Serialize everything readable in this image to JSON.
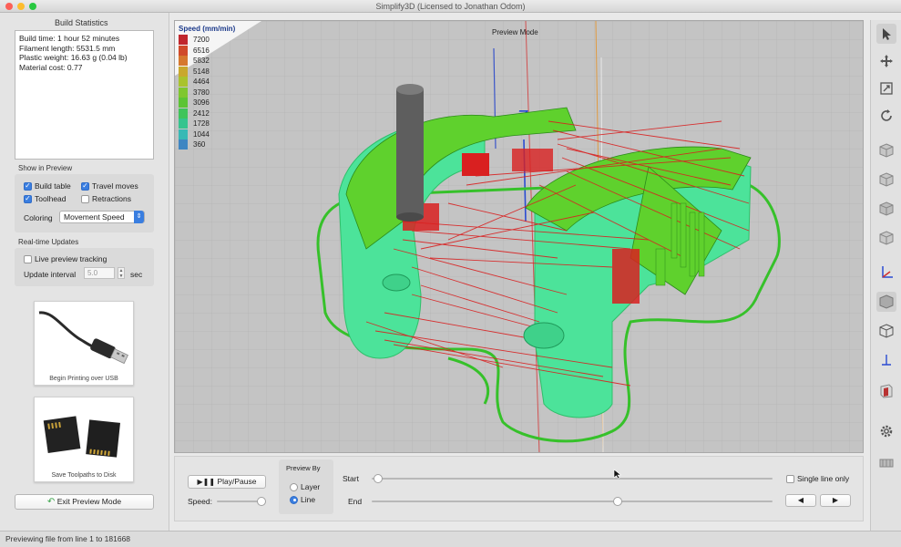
{
  "window": {
    "title": "Simplify3D (Licensed to Jonathan Odom)"
  },
  "build_stats": {
    "title": "Build Statistics",
    "lines": [
      "Build time: 1 hour 52 minutes",
      "Filament length: 5531.5 mm",
      "Plastic weight: 16.63 g (0.04 lb)",
      "Material cost: 0.77"
    ]
  },
  "show_in_preview": {
    "title": "Show in Preview",
    "build_table": "Build table",
    "travel_moves": "Travel moves",
    "toolhead": "Toolhead",
    "retractions": "Retractions",
    "coloring_label": "Coloring",
    "coloring_value": "Movement Speed"
  },
  "realtime": {
    "title": "Real-time Updates",
    "live_tracking": "Live preview tracking",
    "interval_label": "Update interval",
    "interval_value": "5.0",
    "interval_unit": "sec"
  },
  "cards": {
    "usb": "Begin Printing over USB",
    "sd": "Save Toolpaths to Disk"
  },
  "exit_button": "Exit Preview Mode",
  "viewport": {
    "title": "Preview Mode",
    "legend_title": "Speed (mm/min)",
    "legend": [
      {
        "value": "7200",
        "color": "#c0272d"
      },
      {
        "value": "6516",
        "color": "#d04a2a"
      },
      {
        "value": "5832",
        "color": "#d6782e"
      },
      {
        "value": "5148",
        "color": "#c9a82c"
      },
      {
        "value": "4464",
        "color": "#a9c32c"
      },
      {
        "value": "3780",
        "color": "#7fc72e"
      },
      {
        "value": "3096",
        "color": "#5cc434"
      },
      {
        "value": "2412",
        "color": "#3fc45a"
      },
      {
        "value": "1728",
        "color": "#35c48e"
      },
      {
        "value": "1044",
        "color": "#37b9b5"
      },
      {
        "value": "360",
        "color": "#3f86c2"
      }
    ]
  },
  "playback": {
    "play_pause": "Play/Pause",
    "speed_label": "Speed:",
    "preview_by": "Preview By",
    "layer": "Layer",
    "line": "Line",
    "start": "Start",
    "end": "End",
    "single_line": "Single line only",
    "prev": "◀",
    "next": "▶"
  },
  "status": "Previewing file from line 1 to 181668"
}
